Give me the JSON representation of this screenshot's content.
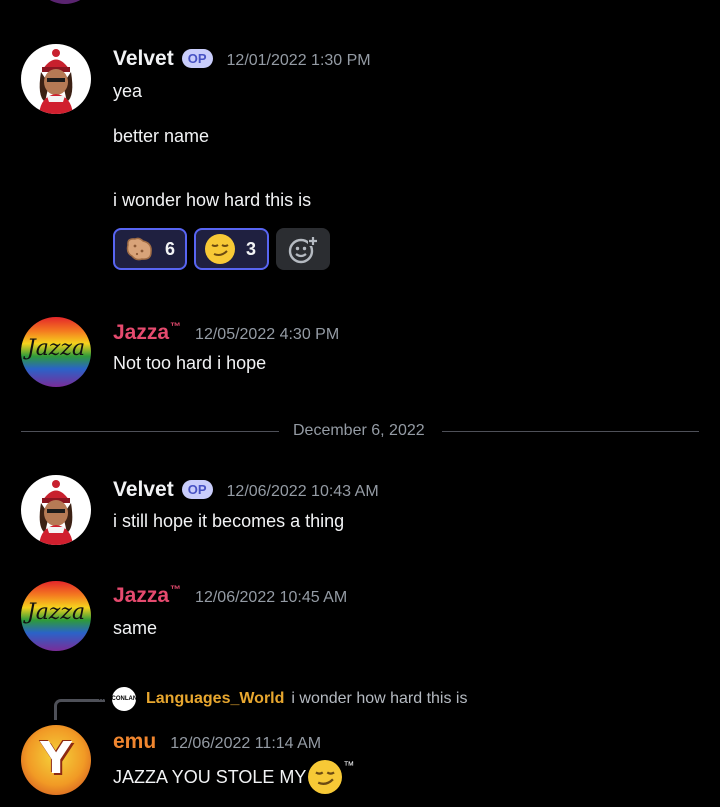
{
  "colors": {
    "background": "#000000",
    "velvet_name": "#f2f3f5",
    "jazza_name": "#e54a6e",
    "emu_name": "#f0862f",
    "op_badge_bg": "#c9cdfb",
    "reaction_border": "#5865f2",
    "timestamp": "#949ba4",
    "reply_name": "#e8a72f"
  },
  "messages": [
    {
      "author": "Velvet",
      "badge": "OP",
      "timestamp": "12/01/2022 1:30 PM",
      "lines": [
        "yea",
        "better name",
        "i wonder how hard this is"
      ],
      "reactions": [
        {
          "emoji": "potato-emoji",
          "count": "6"
        },
        {
          "emoji": "smirk-emoji",
          "count": "3"
        }
      ],
      "add_reaction_icon": "add-reaction-icon"
    },
    {
      "author": "Jazza",
      "author_suffix": "™",
      "avatar_text": "Jazza",
      "timestamp": "12/05/2022 4:30 PM",
      "lines": [
        "Not too hard i hope"
      ]
    }
  ],
  "date_divider": "December 6, 2022",
  "messages2": [
    {
      "author": "Velvet",
      "badge": "OP",
      "timestamp": "12/06/2022 10:43 AM",
      "lines": [
        "i still hope it becomes a thing"
      ]
    },
    {
      "author": "Jazza",
      "author_suffix": "™",
      "avatar_text": "Jazza",
      "timestamp": "12/06/2022 10:45 AM",
      "lines": [
        "same"
      ]
    },
    {
      "reply_to": {
        "avatar_text": "THE CONLANGER",
        "author": "Languages_World",
        "text": "i wonder how hard this is"
      },
      "author": "emu",
      "avatar_text": "Y",
      "timestamp": "12/06/2022 11:14 AM",
      "text_before_emoji": "JAZZA YOU STOLE MY",
      "emoji": "smirk-emoji",
      "text_after_emoji": "™"
    }
  ]
}
